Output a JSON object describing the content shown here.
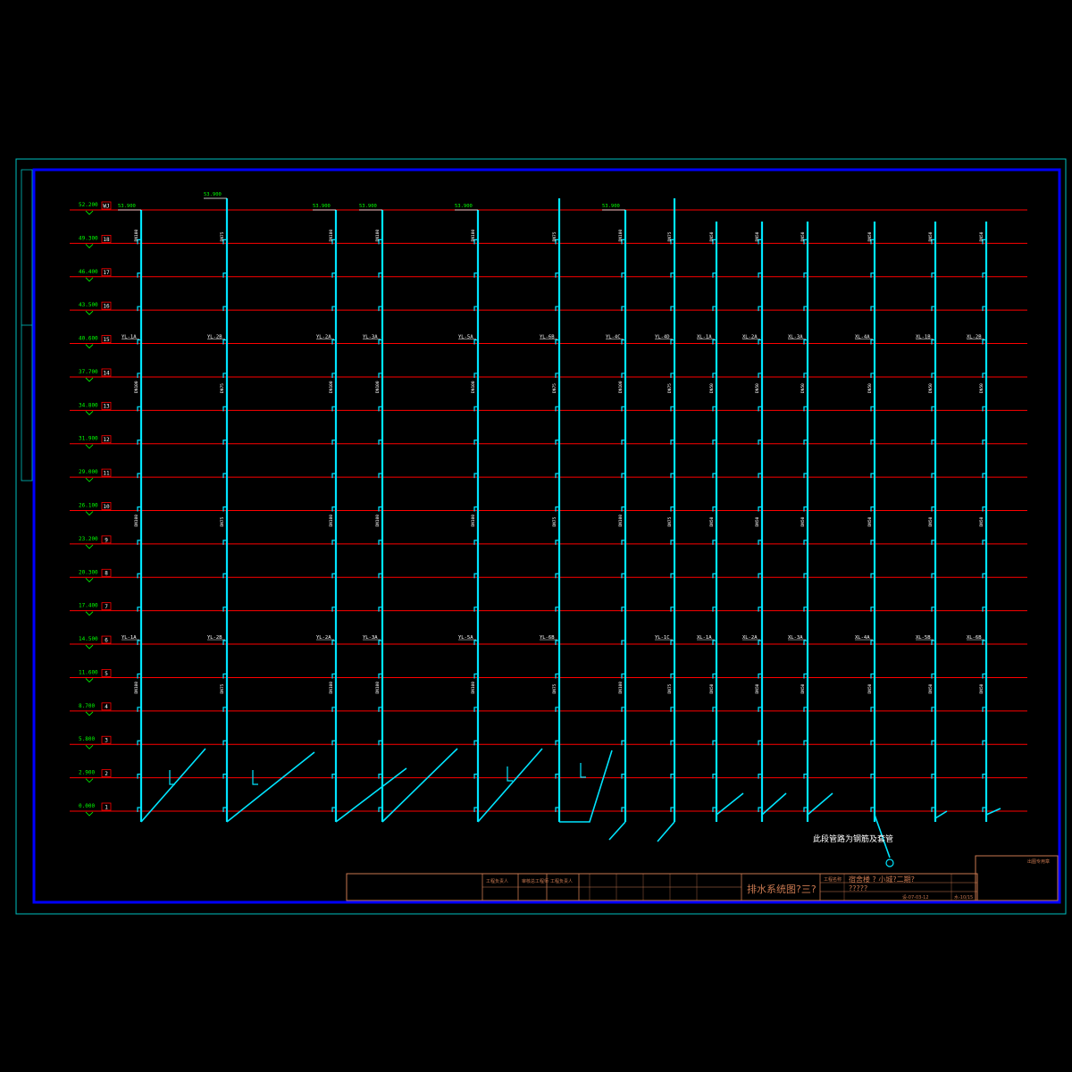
{
  "drawing": {
    "title": "排水系统图?三?",
    "project": "?????",
    "note": "此段管路为钢筋及套管",
    "colors": {
      "background": "#000000",
      "outer_frame": "#00c0c0",
      "inner_frame": "#0000ff",
      "floor_line": "#ff0000",
      "pipe": "#00e5ff",
      "elevation": "#00ff00",
      "label": "#ffffff",
      "titleblock": "#c87850"
    }
  },
  "floors": [
    {
      "no": "WJ",
      "elev": "52.200"
    },
    {
      "no": "18",
      "elev": "49.300"
    },
    {
      "no": "17",
      "elev": "46.400"
    },
    {
      "no": "16",
      "elev": "43.500"
    },
    {
      "no": "15",
      "elev": "40.600"
    },
    {
      "no": "14",
      "elev": "37.700"
    },
    {
      "no": "13",
      "elev": "34.800"
    },
    {
      "no": "12",
      "elev": "31.900"
    },
    {
      "no": "11",
      "elev": "29.000"
    },
    {
      "no": "10",
      "elev": "26.100"
    },
    {
      "no": "9",
      "elev": "23.200"
    },
    {
      "no": "8",
      "elev": "20.300"
    },
    {
      "no": "7",
      "elev": "17.400"
    },
    {
      "no": "6",
      "elev": "14.500"
    },
    {
      "no": "5",
      "elev": "11.600"
    },
    {
      "no": "4",
      "elev": "8.700"
    },
    {
      "no": "3",
      "elev": "5.800"
    },
    {
      "no": "2",
      "elev": "2.900"
    },
    {
      "no": "1",
      "elev": "0.000"
    }
  ],
  "risers": [
    {
      "upper_label": "YL-1A",
      "lower_label": "YL-1A",
      "dn": "DN100",
      "top_elev": "53.900"
    },
    {
      "upper_label": "YL-2B",
      "lower_label": "YL-2B",
      "dn": "DN75",
      "top_elev": "53.900"
    },
    {
      "upper_label": "YL-2A",
      "lower_label": "YL-2A",
      "dn": "DN100",
      "top_elev": "53.900"
    },
    {
      "upper_label": "YL-3A",
      "lower_label": "YL-3A",
      "dn": "DN100",
      "top_elev": "53.900"
    },
    {
      "upper_label": "YL-5A",
      "lower_label": "YL-5A",
      "dn": "DN100",
      "top_elev": "53.900"
    },
    {
      "upper_label": "YL-6B",
      "lower_label": "YL-6B",
      "dn": "DN75",
      "top_elev": ""
    },
    {
      "upper_label": "YL-4C",
      "lower_label": "",
      "dn": "DN100",
      "top_elev": "53.900"
    },
    {
      "upper_label": "YL-4D",
      "lower_label": "YL-1C",
      "dn": "DN75",
      "top_elev": ""
    },
    {
      "upper_label": "XL-1A",
      "lower_label": "XL-1A",
      "dn": "DN50",
      "top_elev": ""
    },
    {
      "upper_label": "XL-2A",
      "lower_label": "XL-2A",
      "dn": "DN50",
      "top_elev": ""
    },
    {
      "upper_label": "XL-3A",
      "lower_label": "XL-3A",
      "dn": "DN50",
      "top_elev": ""
    },
    {
      "upper_label": "XL-4A",
      "lower_label": "XL-4A",
      "dn": "DN50",
      "top_elev": ""
    },
    {
      "upper_label": "XL-1B",
      "lower_label": "XL-5B",
      "dn": "DN50",
      "top_elev": ""
    },
    {
      "upper_label": "XL-2B",
      "lower_label": "XL-6B",
      "dn": "DN50",
      "top_elev": ""
    }
  ],
  "titleblock": {
    "sign_cols": [
      "工程负责人",
      "审核总工程师",
      "工程负责人"
    ],
    "project_label": "工程名称",
    "project_value": "宿舍楼 ? 小城?二期?",
    "drawing_no": "设-07-03-12",
    "sheet": "水-10/15",
    "stamp": "出图专用章"
  }
}
